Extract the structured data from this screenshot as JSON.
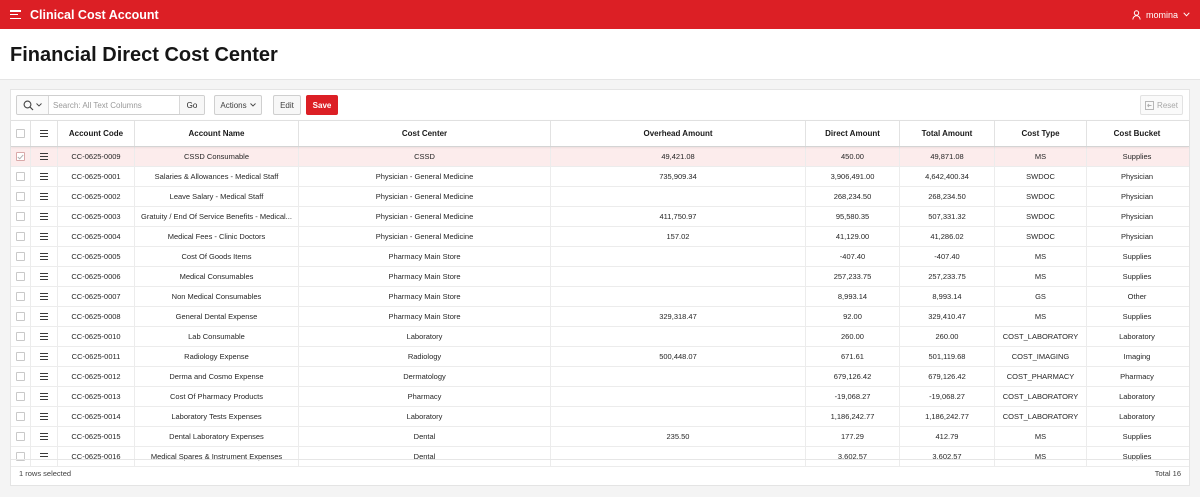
{
  "app": {
    "title": "Clinical Cost Account",
    "user": "momina"
  },
  "page": {
    "title": "Financial Direct Cost Center"
  },
  "toolbar": {
    "search_placeholder": "Search: All Text Columns",
    "go_label": "Go",
    "actions_label": "Actions",
    "edit_label": "Edit",
    "save_label": "Save",
    "reset_label": "Reset"
  },
  "columns": [
    "Account Code",
    "Account Name",
    "Cost Center",
    "Overhead Amount",
    "Direct Amount",
    "Total Amount",
    "Cost Type",
    "Cost Bucket"
  ],
  "rows": [
    {
      "code": "CC-0625-0009",
      "name": "CSSD Consumable",
      "center": "CSSD",
      "overhead": "49,421.08",
      "direct": "450.00",
      "total": "49,871.08",
      "type": "MS",
      "bucket": "Supplies"
    },
    {
      "code": "CC-0625-0001",
      "name": "Salaries & Allowances - Medical Staff",
      "center": "Physician - General Medicine",
      "overhead": "735,909.34",
      "direct": "3,906,491.00",
      "total": "4,642,400.34",
      "type": "SWDOC",
      "bucket": "Physician"
    },
    {
      "code": "CC-0625-0002",
      "name": "Leave Salary - Medical Staff",
      "center": "Physician - General Medicine",
      "overhead": "",
      "direct": "268,234.50",
      "total": "268,234.50",
      "type": "SWDOC",
      "bucket": "Physician"
    },
    {
      "code": "CC-0625-0003",
      "name": "Gratuity / End Of Service Benefits - Medical...",
      "center": "Physician - General Medicine",
      "overhead": "411,750.97",
      "direct": "95,580.35",
      "total": "507,331.32",
      "type": "SWDOC",
      "bucket": "Physician"
    },
    {
      "code": "CC-0625-0004",
      "name": "Medical Fees - Clinic Doctors",
      "center": "Physician - General Medicine",
      "overhead": "157.02",
      "direct": "41,129.00",
      "total": "41,286.02",
      "type": "SWDOC",
      "bucket": "Physician"
    },
    {
      "code": "CC-0625-0005",
      "name": "Cost Of Goods Items",
      "center": "Pharmacy Main Store",
      "overhead": "",
      "direct": "-407.40",
      "total": "-407.40",
      "type": "MS",
      "bucket": "Supplies"
    },
    {
      "code": "CC-0625-0006",
      "name": "Medical Consumables",
      "center": "Pharmacy Main Store",
      "overhead": "",
      "direct": "257,233.75",
      "total": "257,233.75",
      "type": "MS",
      "bucket": "Supplies"
    },
    {
      "code": "CC-0625-0007",
      "name": "Non Medical Consumables",
      "center": "Pharmacy Main Store",
      "overhead": "",
      "direct": "8,993.14",
      "total": "8,993.14",
      "type": "GS",
      "bucket": "Other"
    },
    {
      "code": "CC-0625-0008",
      "name": "General Dental Expense",
      "center": "Pharmacy Main Store",
      "overhead": "329,318.47",
      "direct": "92.00",
      "total": "329,410.47",
      "type": "MS",
      "bucket": "Supplies"
    },
    {
      "code": "CC-0625-0010",
      "name": "Lab Consumable",
      "center": "Laboratory",
      "overhead": "",
      "direct": "260.00",
      "total": "260.00",
      "type": "COST_LABORATORY",
      "bucket": "Laboratory"
    },
    {
      "code": "CC-0625-0011",
      "name": "Radiology Expense",
      "center": "Radiology",
      "overhead": "500,448.07",
      "direct": "671.61",
      "total": "501,119.68",
      "type": "COST_IMAGING",
      "bucket": "Imaging"
    },
    {
      "code": "CC-0625-0012",
      "name": "Derma and Cosmo Expense",
      "center": "Dermatology",
      "overhead": "",
      "direct": "679,126.42",
      "total": "679,126.42",
      "type": "COST_PHARMACY",
      "bucket": "Pharmacy"
    },
    {
      "code": "CC-0625-0013",
      "name": "Cost Of Pharmacy Products",
      "center": "Pharmacy",
      "overhead": "",
      "direct": "-19,068.27",
      "total": "-19,068.27",
      "type": "COST_LABORATORY",
      "bucket": "Laboratory"
    },
    {
      "code": "CC-0625-0014",
      "name": "Laboratory Tests Expenses",
      "center": "Laboratory",
      "overhead": "",
      "direct": "1,186,242.77",
      "total": "1,186,242.77",
      "type": "COST_LABORATORY",
      "bucket": "Laboratory"
    },
    {
      "code": "CC-0625-0015",
      "name": "Dental Laboratory Expenses",
      "center": "Dental",
      "overhead": "235.50",
      "direct": "177.29",
      "total": "412.79",
      "type": "MS",
      "bucket": "Supplies"
    },
    {
      "code": "CC-0625-0016",
      "name": "Medical Spares & Instrument Expenses",
      "center": "Dental",
      "overhead": "",
      "direct": "3,602.57",
      "total": "3,602.57",
      "type": "MS",
      "bucket": "Supplies"
    }
  ],
  "selected_row": 0,
  "footer": {
    "selected_text": "1 rows selected",
    "total_text": "Total 16"
  },
  "colors": {
    "brand": "#dc1f25",
    "selected_row": "#fcecec"
  }
}
